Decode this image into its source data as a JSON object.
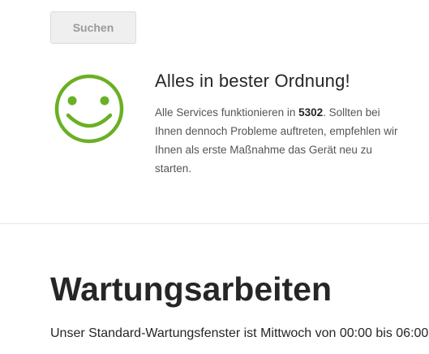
{
  "search": {
    "button_label": "Suchen"
  },
  "status": {
    "icon": "smiley-face-icon",
    "icon_color": "#6ab023",
    "title": "Alles in bester Ordnung!",
    "text_before": "Alle Services funktionieren in ",
    "location_code": "5302",
    "text_after": ". Sollten bei Ihnen dennoch Probleme auftreten, empfehlen wir Ihnen als erste Maßnahme das Gerät neu zu starten."
  },
  "maintenance": {
    "title": "Wartungsarbeiten",
    "text": "Unser Standard-Wartungsfenster ist Mittwoch von 00:00 bis 06:00"
  }
}
